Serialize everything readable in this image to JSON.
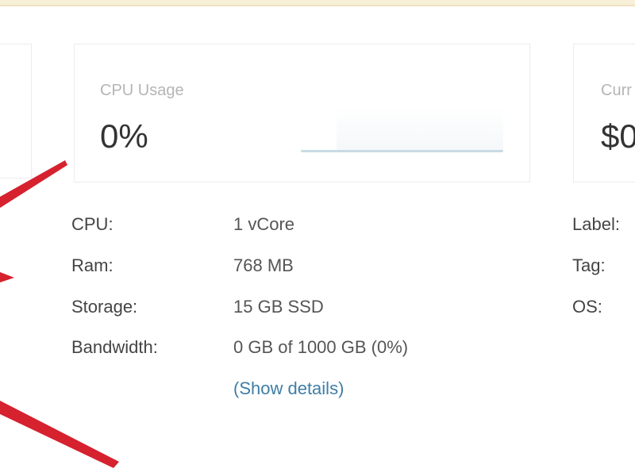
{
  "cards": {
    "cpu_usage": {
      "label": "CPU Usage",
      "value": "0%"
    },
    "right_card": {
      "label": "Curr",
      "value": "$0"
    }
  },
  "specs": [
    {
      "label": "CPU:",
      "value": "1 vCore"
    },
    {
      "label": "Ram:",
      "value": "768 MB"
    },
    {
      "label": "Storage:",
      "value": "15 GB SSD"
    },
    {
      "label": "Bandwidth:",
      "value": "0 GB of 1000 GB (0%)"
    }
  ],
  "show_details": "(Show details)",
  "meta": [
    {
      "label": "Label:"
    },
    {
      "label": "Tag:"
    },
    {
      "label": "OS:"
    }
  ],
  "colors": {
    "accent_red": "#d6212f",
    "link_blue": "#3f7ea6",
    "banner": "#f7efd8"
  }
}
